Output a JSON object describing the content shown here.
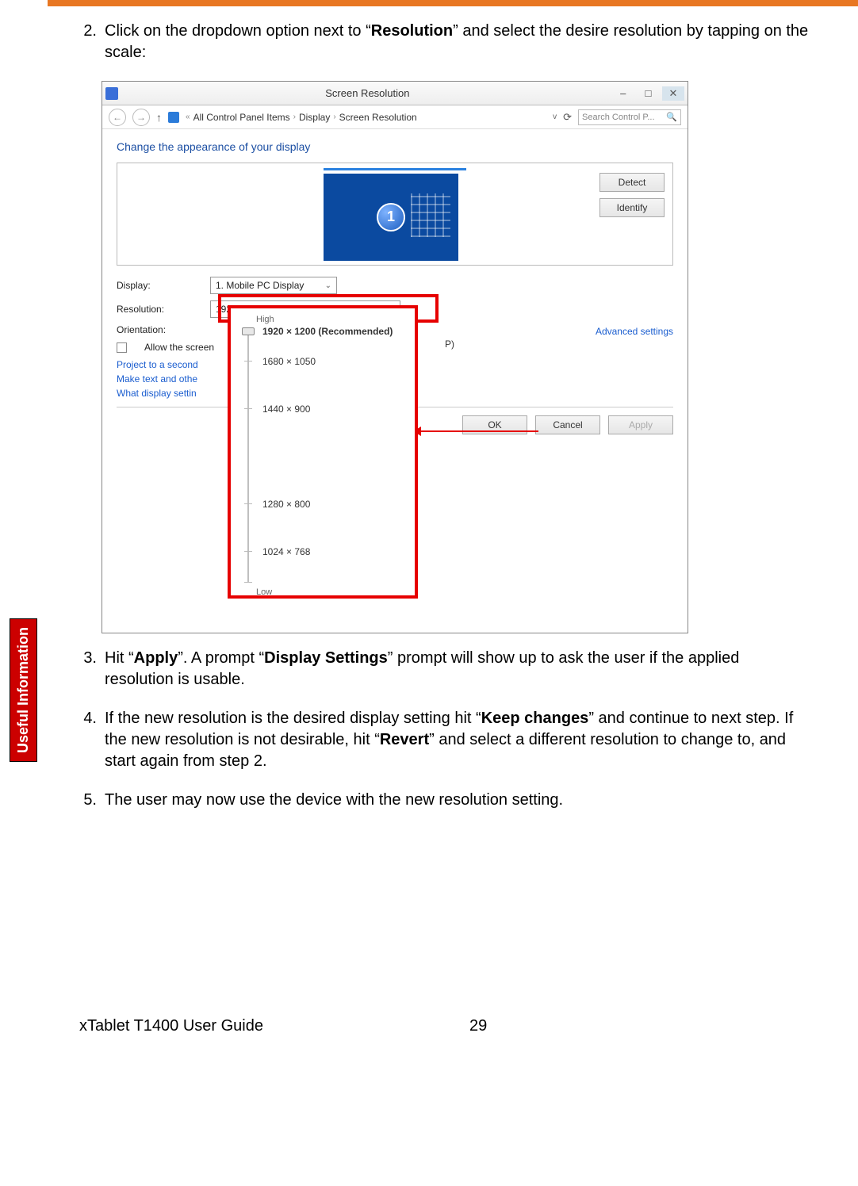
{
  "side_tab": "Useful Information",
  "steps": {
    "s2": {
      "num": "2.",
      "pre": "Click on the dropdown option next to “",
      "bold": "Resolution",
      "post": "” and select the desire resolution by tapping on the scale:"
    },
    "s3": {
      "num": "3.",
      "p1": "Hit “",
      "b1": "Apply",
      "p2": "”. A prompt “",
      "b2": "Display Settings",
      "p3": "” prompt will show up to ask the user if the applied resolution is usable."
    },
    "s4": {
      "num": "4.",
      "p1": "If the new resolution is the desired display setting hit “",
      "b1": "Keep changes",
      "p2": "” and continue to next step. If the new resolution is not desirable, hit “",
      "b2": "Revert",
      "p3": "” and select a different resolution to change to, and start again from step 2."
    },
    "s5": {
      "num": "5.",
      "text": "The user may now use the device with the new resolution setting."
    }
  },
  "shot": {
    "title": "Screen Resolution",
    "min": "–",
    "max": "□",
    "close": "✕",
    "back": "←",
    "fwd": "→",
    "up": "↑",
    "crumb1": "All Control Panel Items",
    "crumb2": "Display",
    "crumb3": "Screen Resolution",
    "refresh": "⟳",
    "search_ph": "Search Control P...",
    "mag": "🔍",
    "headline": "Change the appearance of your display",
    "detect": "Detect",
    "identify": "Identify",
    "monnum": "1",
    "lbl_display": "Display:",
    "val_display": "1. Mobile PC Display",
    "lbl_res": "Resolution:",
    "val_res": "1920 × 1200 (Recommended)",
    "lbl_orient": "Orientation:",
    "allow": "Allow the screen",
    "advanced": "Advanced settings",
    "link1": "Project to a second",
    "link2": "Make text and othe",
    "link3": "What display settin",
    "behind_p": "P)",
    "ok": "OK",
    "cancel": "Cancel",
    "apply": "Apply",
    "slider": {
      "high": "High",
      "low": "Low",
      "r1": "1920 × 1200 (Recommended)",
      "r2": "1680 × 1050",
      "r3": "1440 × 900",
      "r4": "1280 × 800",
      "r5": "1024 × 768"
    }
  },
  "footer": {
    "guide": "xTablet T1400 User Guide",
    "page": "29"
  }
}
